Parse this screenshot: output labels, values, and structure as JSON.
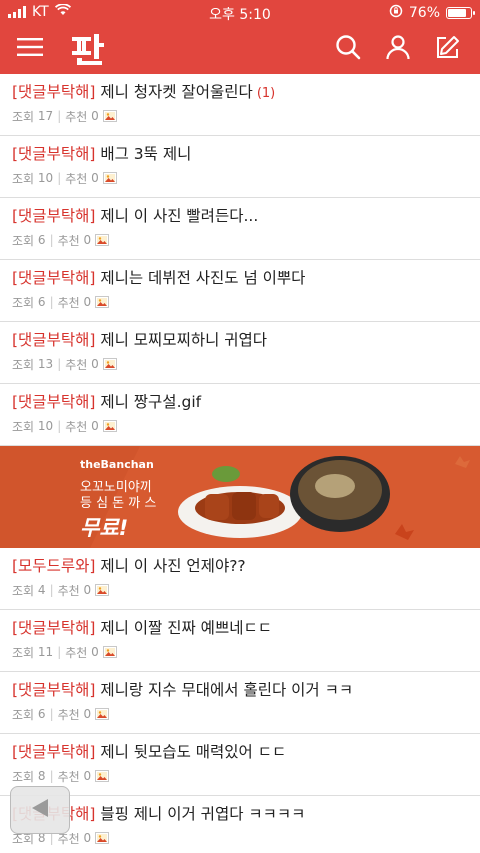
{
  "status_bar": {
    "carrier": "KT",
    "time": "오후 5:10",
    "battery": "76%",
    "battery_level": 0.76
  },
  "header": {
    "menu_icon": "hamburger-icon",
    "logo": "판",
    "search_icon": "search-icon",
    "user_icon": "user-icon",
    "write_icon": "compose-icon"
  },
  "posts_top": [
    {
      "tag": "[댓글부탁해]",
      "title": "제니 청자켓 잘어울린다",
      "replies": "(1)",
      "views_label": "조회",
      "views": "17",
      "likes_label": "추천",
      "likes": "0"
    },
    {
      "tag": "[댓글부탁해]",
      "title": "배그 3뚝 제니",
      "replies": "",
      "views_label": "조회",
      "views": "10",
      "likes_label": "추천",
      "likes": "0"
    },
    {
      "tag": "[댓글부탁해]",
      "title": "제니 이 사진 빨려든다...",
      "replies": "",
      "views_label": "조회",
      "views": "6",
      "likes_label": "추천",
      "likes": "0"
    },
    {
      "tag": "[댓글부탁해]",
      "title": "제니는 데뷔전 사진도 넘 이뿌다",
      "replies": "",
      "views_label": "조회",
      "views": "6",
      "likes_label": "추천",
      "likes": "0"
    },
    {
      "tag": "[댓글부탁해]",
      "title": "제니 모찌모찌하니 귀엽다",
      "replies": "",
      "views_label": "조회",
      "views": "13",
      "likes_label": "추천",
      "likes": "0"
    },
    {
      "tag": "[댓글부탁해]",
      "title": "제니 짱구설.gif",
      "replies": "",
      "views_label": "조회",
      "views": "10",
      "likes_label": "추천",
      "likes": "0"
    }
  ],
  "ad": {
    "brand": "theBanchan",
    "line1": "오꼬노미야끼",
    "line2": "등 심 돈 까 스",
    "free": "무료!"
  },
  "posts_bottom": [
    {
      "tag": "[모두드루와]",
      "title": "제니 이 사진 언제야??",
      "replies": "",
      "views_label": "조회",
      "views": "4",
      "likes_label": "추천",
      "likes": "0"
    },
    {
      "tag": "[댓글부탁해]",
      "title": "제니 이짤 진짜 예쁘네ㄷㄷ",
      "replies": "",
      "views_label": "조회",
      "views": "11",
      "likes_label": "추천",
      "likes": "0"
    },
    {
      "tag": "[댓글부탁해]",
      "title": "제니랑 지수 무대에서 홀린다 이거 ㅋㅋ",
      "replies": "",
      "views_label": "조회",
      "views": "6",
      "likes_label": "추천",
      "likes": "0"
    },
    {
      "tag": "[댓글부탁해]",
      "title": "제니 뒷모습도 매력있어 ㄷㄷ",
      "replies": "",
      "views_label": "조회",
      "views": "8",
      "likes_label": "추천",
      "likes": "0"
    },
    {
      "tag": "[댓글부탁해]",
      "title": "블핑 제니 이거 귀엽다 ㅋㅋㅋㅋ",
      "replies": "",
      "views_label": "조회",
      "views": "8",
      "likes_label": "추천",
      "likes": "0"
    }
  ],
  "colors": {
    "accent": "#e1463e",
    "tag": "#d7332d"
  }
}
